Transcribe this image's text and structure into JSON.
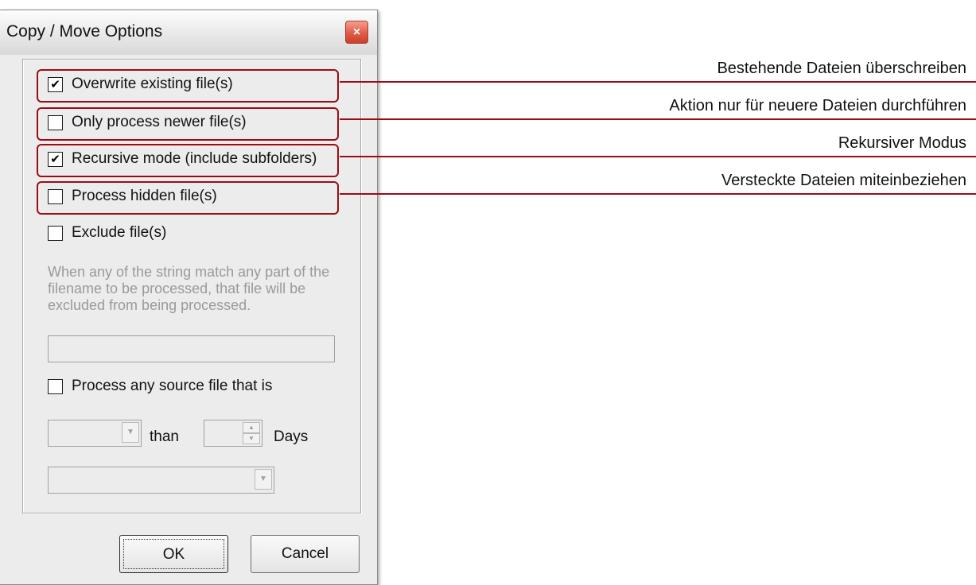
{
  "dialog": {
    "title": "Copy / Move Options",
    "close_icon": "×"
  },
  "options": [
    {
      "label": "Overwrite existing file(s)",
      "checked": true
    },
    {
      "label": "Only process newer file(s)",
      "checked": false
    },
    {
      "label": "Recursive mode (include subfolders)",
      "checked": true
    },
    {
      "label": "Process hidden file(s)",
      "checked": false
    },
    {
      "label": "Exclude file(s)",
      "checked": false
    }
  ],
  "exclude": {
    "description": "When any of the string match any part of the filename to be processed, that file will be excluded from being processed.",
    "value": ""
  },
  "age_filter": {
    "label": "Process any source file that is",
    "checked": false,
    "comparison_value": "",
    "than_label": "than",
    "days_value": "",
    "days_label": "Days",
    "second_select_value": ""
  },
  "buttons": {
    "ok": "OK",
    "cancel": "Cancel"
  },
  "callouts": [
    "Bestehende Dateien überschreiben",
    "Aktion nur für neuere Dateien durchführen",
    "Rekursiver Modus",
    "Versteckte Dateien miteinbeziehen"
  ],
  "colors": {
    "highlight": "#9a0d16",
    "dialog_bg": "#ececec",
    "disabled_text": "#9a9a9a"
  },
  "icons": {
    "close": "close-icon",
    "dropdown": "chevron-down-icon",
    "spin_up": "spin-up-icon",
    "spin_down": "spin-down-icon",
    "check": "✔"
  }
}
